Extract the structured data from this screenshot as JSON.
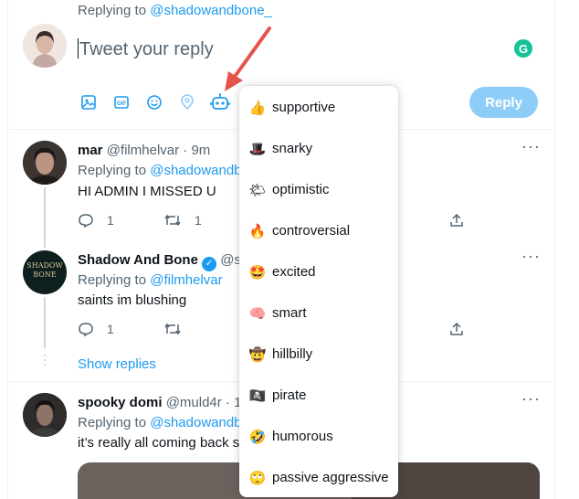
{
  "composer": {
    "replying_prefix": "Replying to",
    "replying_handle": "@shadowandbone_",
    "placeholder": "Tweet your reply",
    "reply_button": "Reply",
    "toolbar_icons": [
      "image-icon",
      "gif-icon",
      "emoji-icon",
      "location-icon",
      "robot-icon"
    ]
  },
  "tweets": [
    {
      "name": "mar",
      "handle": "@filmhelvar",
      "time": "· 9m",
      "replying_prefix": "Replying to",
      "replying_handle": "@shadowandb",
      "text": "HI ADMIN I MISSED U",
      "reply_count": "1",
      "retweet_count": "1"
    },
    {
      "name": "Shadow And Bone",
      "handle": "@s",
      "verified": true,
      "avatar_text": "SHADOW\nBONE",
      "replying_prefix": "Replying to",
      "replying_handle": "@filmhelvar",
      "text": "saints im blushing",
      "reply_count": "1",
      "show_replies": "Show replies"
    },
    {
      "name": "spooky domi",
      "handle": "@muld4r · 1",
      "replying_prefix": "Replying to",
      "replying_handle": "@shadowandb",
      "text": "it’s really all coming back s"
    }
  ],
  "tone_menu": [
    {
      "emoji": "👍",
      "label": "supportive"
    },
    {
      "emoji": "🎩",
      "label": "snarky"
    },
    {
      "emoji": "🌤",
      "label": "optimistic"
    },
    {
      "emoji": "🔥",
      "label": "controversial"
    },
    {
      "emoji": "🤩",
      "label": "excited"
    },
    {
      "emoji": "🧠",
      "label": "smart"
    },
    {
      "emoji": "🤠",
      "label": "hillbilly"
    },
    {
      "emoji": "🏴‍☠️",
      "label": "pirate"
    },
    {
      "emoji": "🤣",
      "label": "humorous"
    },
    {
      "emoji": "🙄",
      "label": "passive aggressive"
    }
  ],
  "colors": {
    "accent": "#1d9bf0",
    "reply_button": "#8ecdf8",
    "grammarly": "#15c39a",
    "arrow": "#e5544b"
  }
}
